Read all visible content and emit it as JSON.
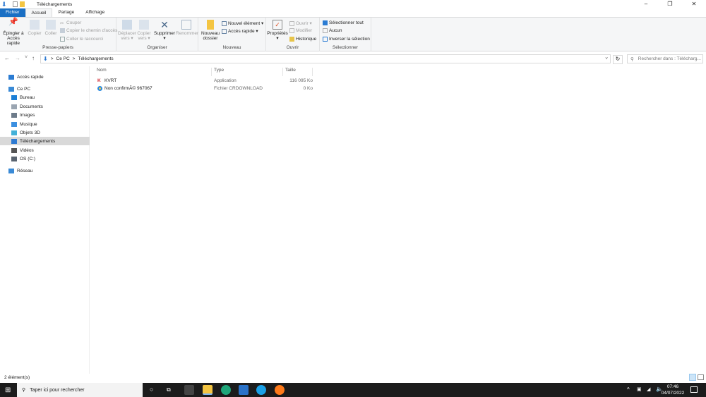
{
  "window": {
    "title": "Téléchargements",
    "controls": [
      "–",
      "❐",
      "✕"
    ]
  },
  "tabs": [
    "Fichier",
    "Accueil",
    "Partage",
    "Affichage"
  ],
  "ribbon": {
    "presse_papiers": {
      "label": "Presse-papiers",
      "pin_line1": "Épingler à",
      "pin_line2": "Accès rapide",
      "copy": "Copier",
      "paste": "Coller",
      "cut": "Couper",
      "copy_path": "Copier le chemin d'accès",
      "paste_shortcut": "Coller le raccourci"
    },
    "organiser": {
      "label": "Organiser",
      "move_line1": "Déplacer",
      "move_line2": "vers ▾",
      "copyto_line1": "Copier",
      "copyto_line2": "vers ▾",
      "delete": "Supprimer",
      "delete_arrow": "▾",
      "rename": "Renommer"
    },
    "nouveau": {
      "label": "Nouveau",
      "newfolder_line1": "Nouveau",
      "newfolder_line2": "dossier",
      "new_item": "Nouvel élément ▾",
      "quick_access": "Accès rapide ▾"
    },
    "ouvrir": {
      "label": "Ouvrir",
      "properties": "Propriétés",
      "properties_arrow": "▾",
      "open": "Ouvrir ▾",
      "edit": "Modifier",
      "history": "Historique"
    },
    "selectionner": {
      "label": "Sélectionner",
      "select_all": "Sélectionner tout",
      "none": "Aucun",
      "invert": "Inverser la sélection"
    }
  },
  "address": {
    "back": "←",
    "forward": "→",
    "recent": "˅",
    "up": "↑",
    "crumbs": [
      "Ce PC",
      "Téléchargements"
    ],
    "sep": ">",
    "dropdown": "˅",
    "refresh": "↻",
    "search_placeholder": "Rechercher dans : Télécharg..."
  },
  "nav": {
    "items": [
      {
        "label": "Accès rapide",
        "icon": "star-icon",
        "color": "#2b7cd3"
      },
      {
        "label": "Ce PC",
        "icon": "computer-icon",
        "color": "#3a8ad6"
      },
      {
        "label": "Bureau",
        "icon": "desktop-icon",
        "color": "#1c7fd6"
      },
      {
        "label": "Documents",
        "icon": "document-icon",
        "color": "#9aa5b1"
      },
      {
        "label": "Images",
        "icon": "images-icon",
        "color": "#6d7b8a"
      },
      {
        "label": "Musique",
        "icon": "music-icon",
        "color": "#3b8fe0"
      },
      {
        "label": "Objets 3D",
        "icon": "cube-icon",
        "color": "#43b1d8"
      },
      {
        "label": "Téléchargements",
        "icon": "download-icon",
        "color": "#2e7ad1"
      },
      {
        "label": "Vidéos",
        "icon": "video-icon",
        "color": "#555"
      },
      {
        "label": "OS (C:)",
        "icon": "drive-icon",
        "color": "#5a6470"
      },
      {
        "label": "Réseau",
        "icon": "network-icon",
        "color": "#3a8ad6"
      }
    ]
  },
  "list": {
    "columns": [
      "Nom",
      "Type",
      "Taille"
    ],
    "rows": [
      {
        "name": "KVRT",
        "type": "Application",
        "size": "116 095 Ko",
        "icon": "kaspersky-icon"
      },
      {
        "name": "Non confirmÃ© 967067",
        "type": "Fichier CRDOWNLOAD",
        "size": "0 Ko",
        "icon": "ie-file-icon"
      }
    ]
  },
  "status": {
    "count": "2 élément(s)"
  },
  "taskbar": {
    "search_placeholder": "Taper ici pour rechercher",
    "time": "07:46",
    "date": "04/07/2022",
    "accent": "#1a6fc4"
  }
}
